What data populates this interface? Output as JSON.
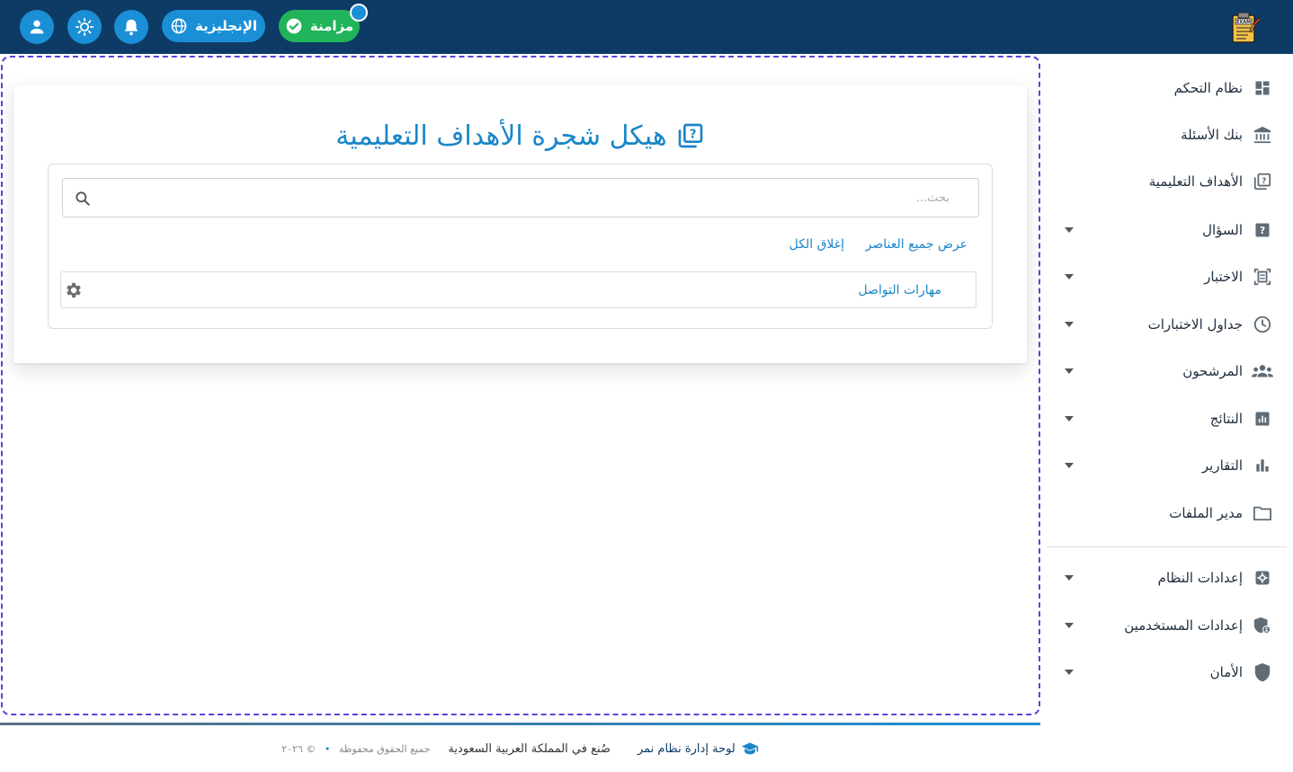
{
  "topbar": {
    "sync_label": "مزامنة",
    "language_label": "الإنجليزية",
    "icons": [
      "user-icon",
      "brightness-icon",
      "bell-icon",
      "globe-icon",
      "check-circle-icon"
    ],
    "logo_text": "EXAM"
  },
  "sidebar": {
    "items": [
      {
        "label": "نظام التحكم",
        "icon": "dashboard-icon",
        "has_submenu": false
      },
      {
        "label": "بنك الأسئلة",
        "icon": "bank-icon",
        "has_submenu": false
      },
      {
        "label": "الأهداف التعليمية",
        "icon": "quiz-book-icon",
        "has_submenu": false
      },
      {
        "label": "السؤال",
        "icon": "question-icon",
        "has_submenu": true
      },
      {
        "label": "الاختبار",
        "icon": "exam-icon",
        "has_submenu": true
      },
      {
        "label": "جداول الاختبارات",
        "icon": "clock-icon",
        "has_submenu": true
      },
      {
        "label": "المرشحون",
        "icon": "people-icon",
        "has_submenu": true
      },
      {
        "label": "النتائج",
        "icon": "results-chart-icon",
        "has_submenu": true
      },
      {
        "label": "التقارير",
        "icon": "bar-chart-icon",
        "has_submenu": true
      },
      {
        "label": "مدير الملفات",
        "icon": "folder-icon",
        "has_submenu": false
      }
    ],
    "settings_items": [
      {
        "label": "إعدادات النظام",
        "icon": "settings-icon",
        "has_submenu": true
      },
      {
        "label": "إعدادات المستخدمين",
        "icon": "user-shield-icon",
        "has_submenu": true
      },
      {
        "label": "الأمان",
        "icon": "shield-icon",
        "has_submenu": true
      }
    ]
  },
  "main": {
    "title": "هيكل شجرة الأهداف التعليمية",
    "search": {
      "placeholder": "بحث...",
      "value": ""
    },
    "expand_all_label": "عرض جميع العناصر",
    "collapse_all_label": "إغلاق الكل",
    "tree_nodes": [
      {
        "label": "مهارات التواصل"
      }
    ]
  },
  "footer": {
    "brand": "لوحة إدارة نظام نمر",
    "made_in": "صُنع في المملكة العربية السعودية",
    "copyright_year": "© ٢٠٢٦",
    "rights": "جميع الحقوق محفوظة"
  },
  "colors": {
    "topbar": "#0d3b66",
    "accent": "#1a86c8",
    "sync": "#21b45b",
    "outline": "#5a44d9"
  }
}
